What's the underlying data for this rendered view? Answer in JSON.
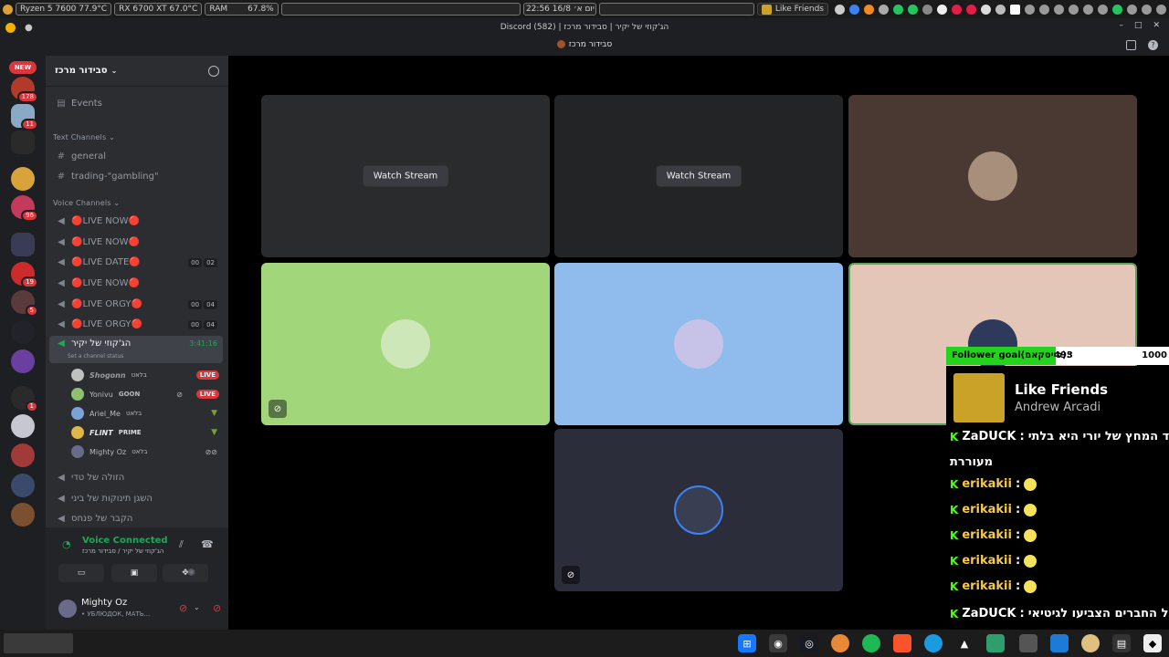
{
  "system_bar": {
    "cpu": "Ryzen 5 7600  77.9°C",
    "gpu": "RX 6700 XT 67.0°C",
    "ram_label": "RAM",
    "ram_value": "67.8%",
    "datetime": "יום א׳ 16/8  22:56",
    "task": "Like Friends"
  },
  "window": {
    "title": "Discord (582) | הג'קוזי של יקיר | סבידור מרכז",
    "minimize_glyph": "–",
    "maximize_glyph": "□",
    "close_glyph": "✕"
  },
  "header": {
    "server_name": "סבידור מרכז"
  },
  "guild_badges": [
    "NEW",
    "178",
    "11",
    "96",
    "19",
    "5",
    "1"
  ],
  "sidebar": {
    "server_name": "סבידור מרכז",
    "events": "Events",
    "text_category": "Text Channels",
    "text_channels": [
      "general",
      "trading-\"gambling\""
    ],
    "voice_category": "Voice Channels",
    "voice_channels": [
      {
        "name": "🔴LIVE NOW🔴",
        "count_a": "",
        "count_b": ""
      },
      {
        "name": "🔴LIVE NOW🔴",
        "count_a": "",
        "count_b": ""
      },
      {
        "name": "🔴LIVE DATE🔴",
        "count_a": "00",
        "count_b": "02"
      },
      {
        "name": "🔴LIVE NOW🔴",
        "count_a": "",
        "count_b": ""
      },
      {
        "name": "🔴LIVE ORGY🔴",
        "count_a": "00",
        "count_b": "04"
      },
      {
        "name": "🔴LIVE ORGY🔴",
        "count_a": "00",
        "count_b": "04"
      }
    ],
    "active_channel": {
      "name": "הג'קוזי של יקיר",
      "timer": "3:41:16",
      "status": "Set a channel status"
    },
    "members": [
      {
        "name": "Shogonn",
        "tag": "בלאט",
        "live": "LIVE",
        "color": "#c0c0c0"
      },
      {
        "name": "Yonivu",
        "tag": "GOON",
        "live": "LIVE",
        "color": "#8fbf6f"
      },
      {
        "name": "Ariel_Me",
        "tag": "בלאט",
        "live": "",
        "color": "#7aa2d6"
      },
      {
        "name": "FLINT",
        "tag": "PRIME",
        "live": "",
        "color": "#e0b64a"
      },
      {
        "name": "Mighty Oz",
        "tag": "בלאט",
        "live": "",
        "color": "#6a6a8a"
      }
    ],
    "more_voice_channels": [
      "הזולה של טדי",
      "השגן תינוקות של ביני",
      "הקבר של פנחס"
    ]
  },
  "voice_panel": {
    "status": "Voice Connected",
    "location": "הג'קוזי של יקיר / סבידור מרכז",
    "user_name": "Mighty Oz",
    "user_status": "• УБЛЮДОК, МАТЬ..."
  },
  "stage": {
    "watch_label_1": "Watch Stream",
    "watch_label_2": "Watch Stream",
    "tile_colors": [
      "#2a2b2d",
      "#232425",
      "#4a3832",
      "#a1d77a",
      "#8fbcec",
      "#e3c6b8",
      "#2b2d3a"
    ]
  },
  "overlay": {
    "goal_label": "Follower goal(פייסקאם):",
    "goal_current": "493",
    "goal_max": "1000",
    "goal_fraction": 0.493,
    "song_title": "Like Friends",
    "song_artist": "Andrew Arcadi",
    "chat": [
      {
        "user": "ZaDUCK",
        "text": "יד המחץ של יורי היא בלתי",
        "color": "#ffffff"
      },
      {
        "user": "",
        "text": "מעוררת",
        "color": "#ffffff"
      },
      {
        "user": "erikakii",
        "text": "",
        "color": "#f7c948"
      },
      {
        "user": "erikakii",
        "text": "",
        "color": "#f7c948"
      },
      {
        "user": "erikakii",
        "text": "",
        "color": "#f7c948"
      },
      {
        "user": "erikakii",
        "text": "",
        "color": "#f7c948"
      },
      {
        "user": "erikakii",
        "text": "",
        "color": "#f7c948"
      },
      {
        "user": "ZaDUCK",
        "text": "כל החברים הצביעו לגיטיאי",
        "color": "#ffffff"
      }
    ]
  },
  "colors": {
    "accent": "#5865f2",
    "voice_green": "#23a55a",
    "live_red": "#da373c",
    "kick_green": "#53fc18"
  }
}
